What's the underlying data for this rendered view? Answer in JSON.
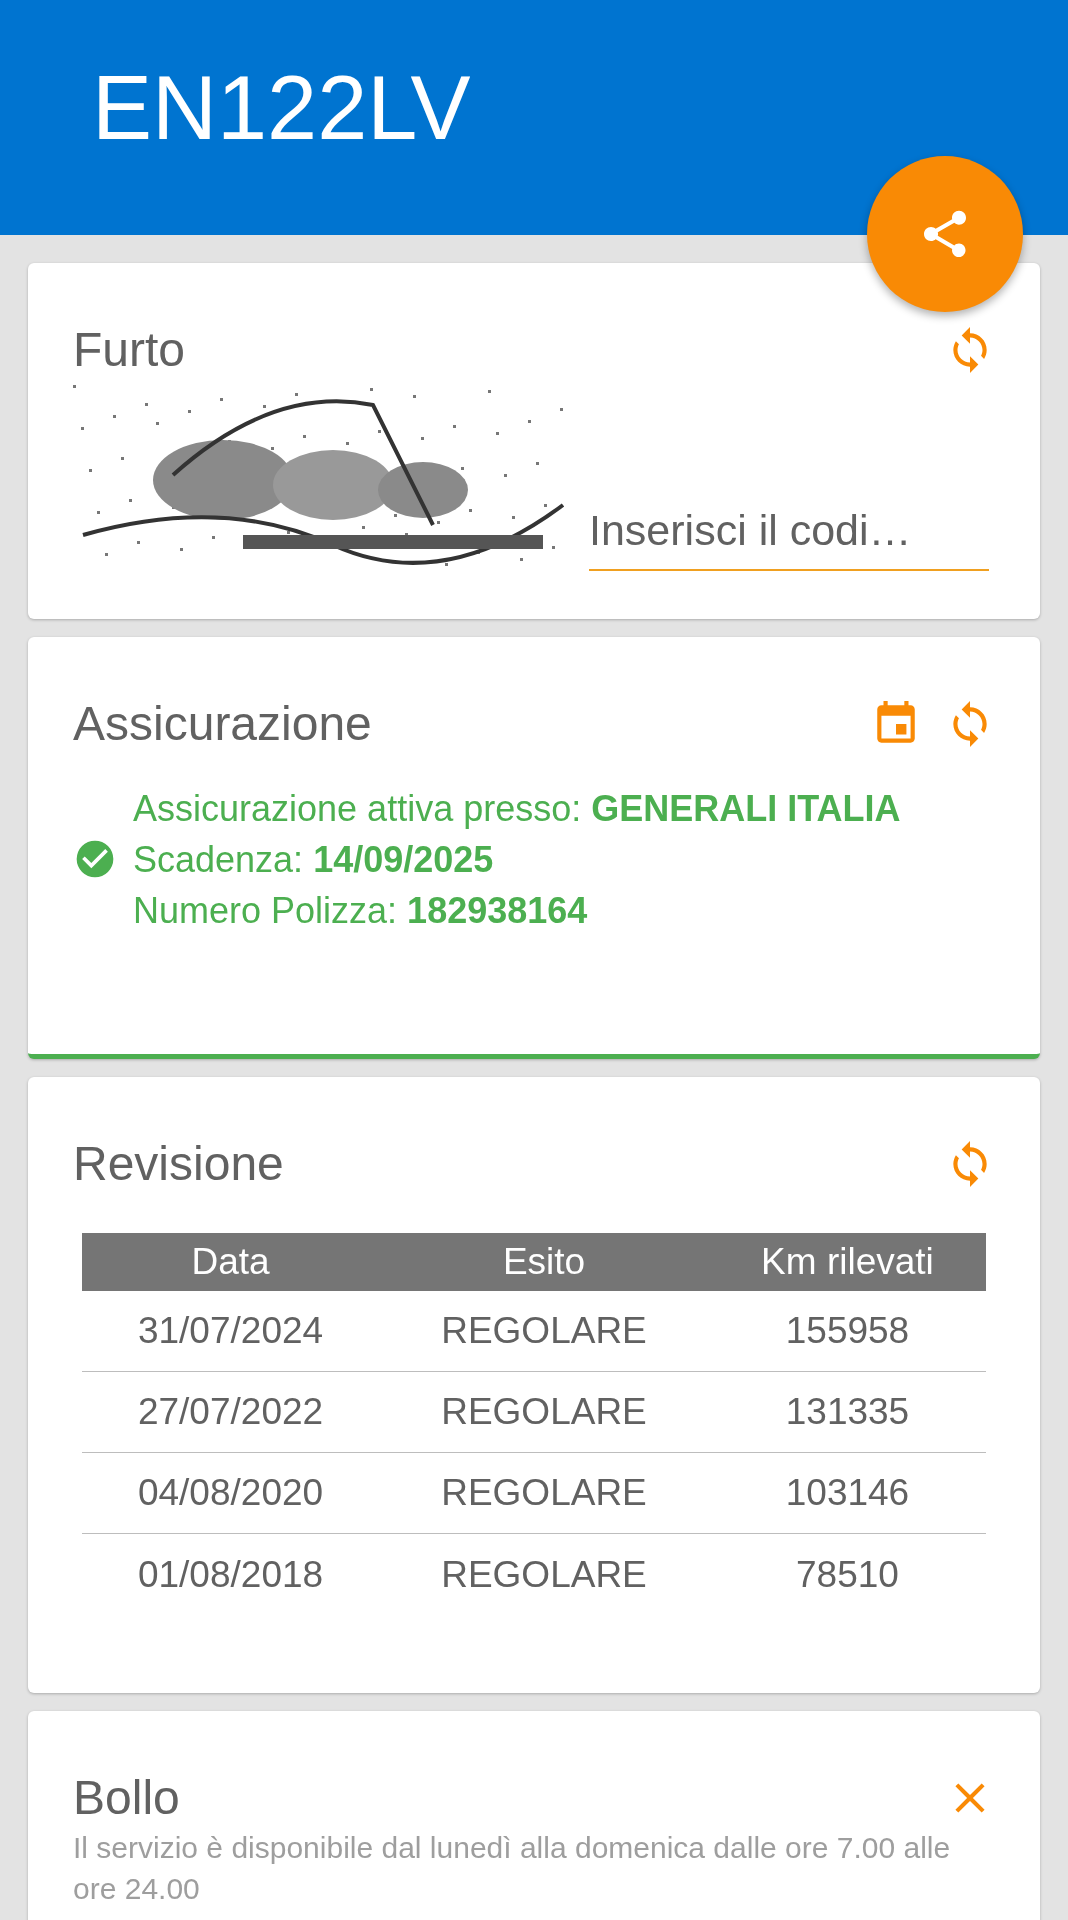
{
  "app_bar": {
    "title": "EN122LV"
  },
  "cards": [
    {
      "kind": "captcha",
      "title": "Furto",
      "code_field": {
        "placeholder": "Inserisci il codi…"
      }
    },
    {
      "kind": "insurance",
      "title": "Assicurazione",
      "insured": true,
      "lines": [
        "Assicurazione attiva presso: **GENERALI ITALIA**",
        "Scadenza: **14/09/2025**",
        "Numero Polizza: **182938164**"
      ]
    },
    {
      "kind": "inspection",
      "title": "Revisione",
      "table": {
        "columns": [
          "Data",
          "Esito",
          "Km rilevati"
        ],
        "rows": [
          [
            "31/07/2024",
            "REGOLARE",
            "155958"
          ],
          [
            "27/07/2022",
            "REGOLARE",
            "131335"
          ],
          [
            "04/08/2020",
            "REGOLARE",
            "103146"
          ],
          [
            "01/08/2018",
            "REGOLARE",
            "78510"
          ]
        ]
      }
    },
    {
      "kind": "tax",
      "title": "Bollo",
      "message": "Il servizio è disponibile dal lunedì alla domenica dalle ore 7.00 alle ore 24.00"
    }
  ]
}
